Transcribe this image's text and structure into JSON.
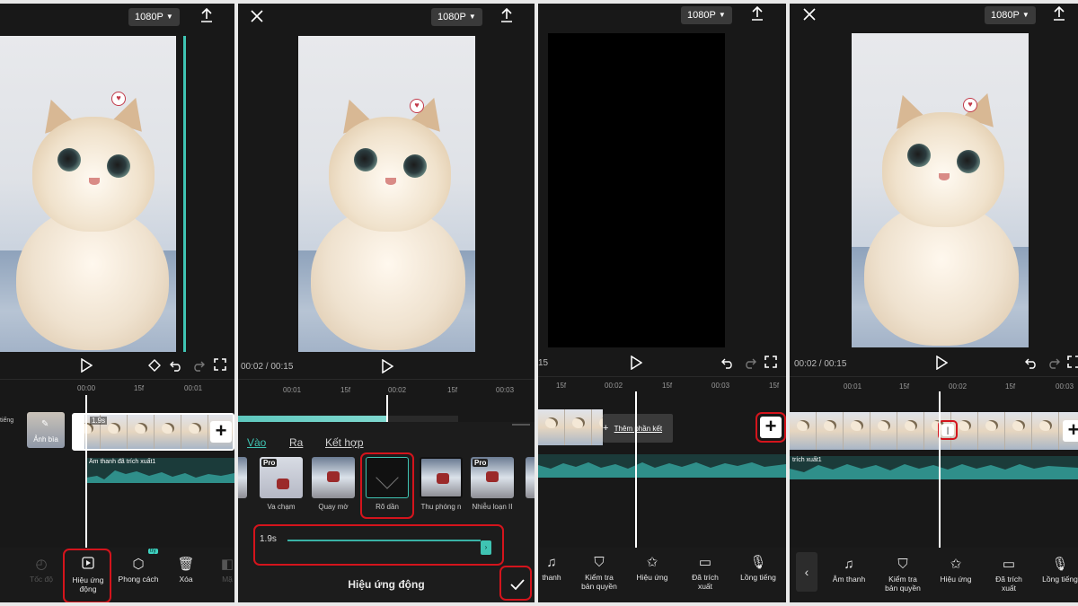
{
  "resolution": "1080P",
  "accent_color": "#3fc4b3",
  "highlight_color": "#d4141c",
  "panel1": {
    "ruler": [
      "00:00",
      "15f",
      "00:01"
    ],
    "cover_label": "Ảnh bìa",
    "side_label": "tiếng",
    "clip_duration": "1.9s",
    "audio_label": "Âm thanh đã trích xuất1",
    "tools": [
      {
        "icon": "speed-icon",
        "label": "Tốc độ"
      },
      {
        "icon": "animation-icon",
        "label": "Hiệu ứng động"
      },
      {
        "icon": "style-cube-icon",
        "label": "Phong cách"
      },
      {
        "icon": "trash-icon",
        "label": "Xóa"
      },
      {
        "icon": "mask-icon",
        "label": "Mặ"
      }
    ],
    "try_badge": "try"
  },
  "panel2": {
    "time": "00:02 / 00:15",
    "ruler": [
      "00:01",
      "15f",
      "00:02",
      "15f",
      "00:03"
    ],
    "tabs": [
      "Vào",
      "Ra",
      "Kết hợp"
    ],
    "effects": [
      {
        "label": "p",
        "pro": false
      },
      {
        "label": "Va chạm",
        "pro": true
      },
      {
        "label": "Quay mờ",
        "pro": false
      },
      {
        "label": "Rõ dần",
        "pro": false
      },
      {
        "label": "Thu phóng n",
        "pro": false
      },
      {
        "label": "Nhiễu loạn II",
        "pro": true
      },
      {
        "label": "T",
        "pro": false
      }
    ],
    "pro_badge": "Pro",
    "duration": "1.9s",
    "duration_fraction": 0.95,
    "title": "Hiệu ứng động"
  },
  "panel3": {
    "time_partial": "15",
    "ruler": [
      "15f",
      "00:02",
      "15f",
      "00:03",
      "15f"
    ],
    "add_ending": "Thêm phần kết",
    "tools": [
      {
        "icon": "music-icon",
        "label": "thanh"
      },
      {
        "icon": "shield-check-icon",
        "label": "Kiểm tra bản quyền"
      },
      {
        "icon": "effects-star-icon",
        "label": "Hiệu ứng"
      },
      {
        "icon": "folder-icon",
        "label": "Đã trích xuất"
      },
      {
        "icon": "microphone-icon",
        "label": "Lồng tiếng"
      }
    ]
  },
  "panel4": {
    "time": "00:02 / 00:15",
    "ruler": [
      "00:01",
      "15f",
      "00:02",
      "15f",
      "00:03"
    ],
    "audio_label": "trích xuất1",
    "tools": [
      {
        "icon": "music-icon",
        "label": "Âm thanh"
      },
      {
        "icon": "shield-check-icon",
        "label": "Kiểm tra bản quyền"
      },
      {
        "icon": "effects-star-icon",
        "label": "Hiệu ứng"
      },
      {
        "icon": "folder-icon",
        "label": "Đã trích xuất"
      },
      {
        "icon": "microphone-icon",
        "label": "Lồng tiếng"
      }
    ]
  }
}
